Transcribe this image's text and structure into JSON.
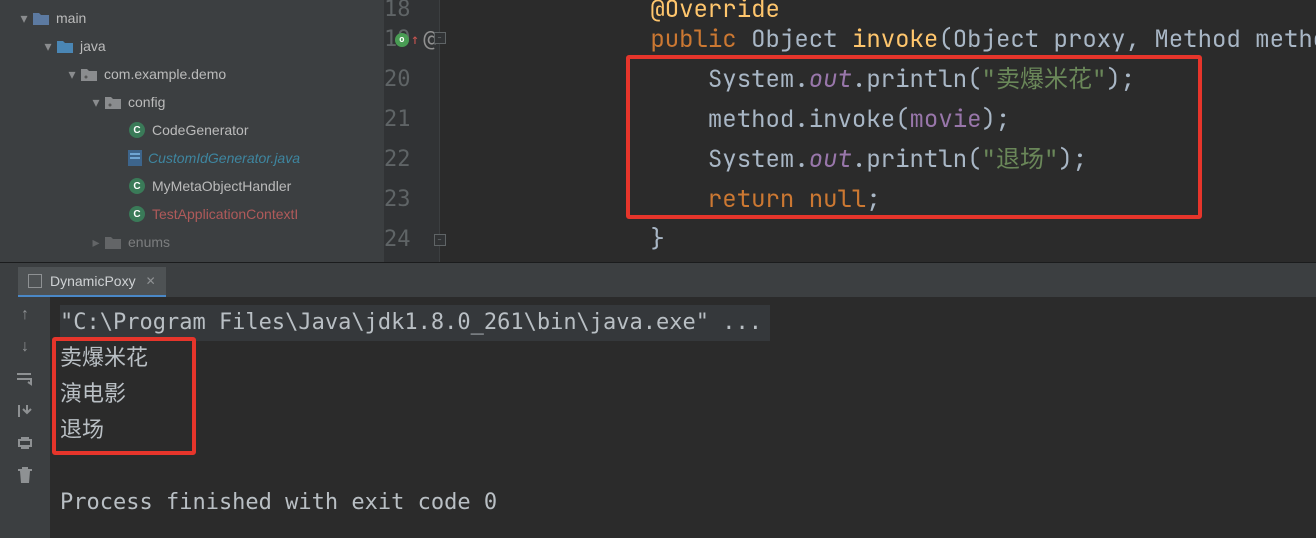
{
  "sidebar": {
    "main": "main",
    "java": "java",
    "pkg": "com.example.demo",
    "config": "config",
    "codeGen": "CodeGenerator",
    "customId": "CustomIdGenerator.java",
    "myMeta": "MyMetaObjectHandler",
    "testApp": "TestApplicationContextI",
    "enums": "enums"
  },
  "editor": {
    "lines": [
      "18",
      "19",
      "20",
      "21",
      "22",
      "23",
      "24"
    ],
    "override": "@Override",
    "public": "public",
    "object": "Object",
    "invoke": "invoke",
    "objectParam": "Object proxy",
    "methodParam": "Method method",
    "system": "System",
    "out": "out",
    "println": "println",
    "str1": "\"卖爆米花\"",
    "methodVar": "method",
    "invokeFn": "invoke",
    "movie": "movie",
    "str2": "\"退场\"",
    "return": "return",
    "null": "null",
    "brace": "}"
  },
  "run": {
    "tab": "DynamicPoxy",
    "cmd": "\"C:\\Program Files\\Java\\jdk1.8.0_261\\bin\\java.exe\" ...",
    "out1": "卖爆米花",
    "out2": "演电影",
    "out3": "退场",
    "exit": "Process finished with exit code 0"
  }
}
